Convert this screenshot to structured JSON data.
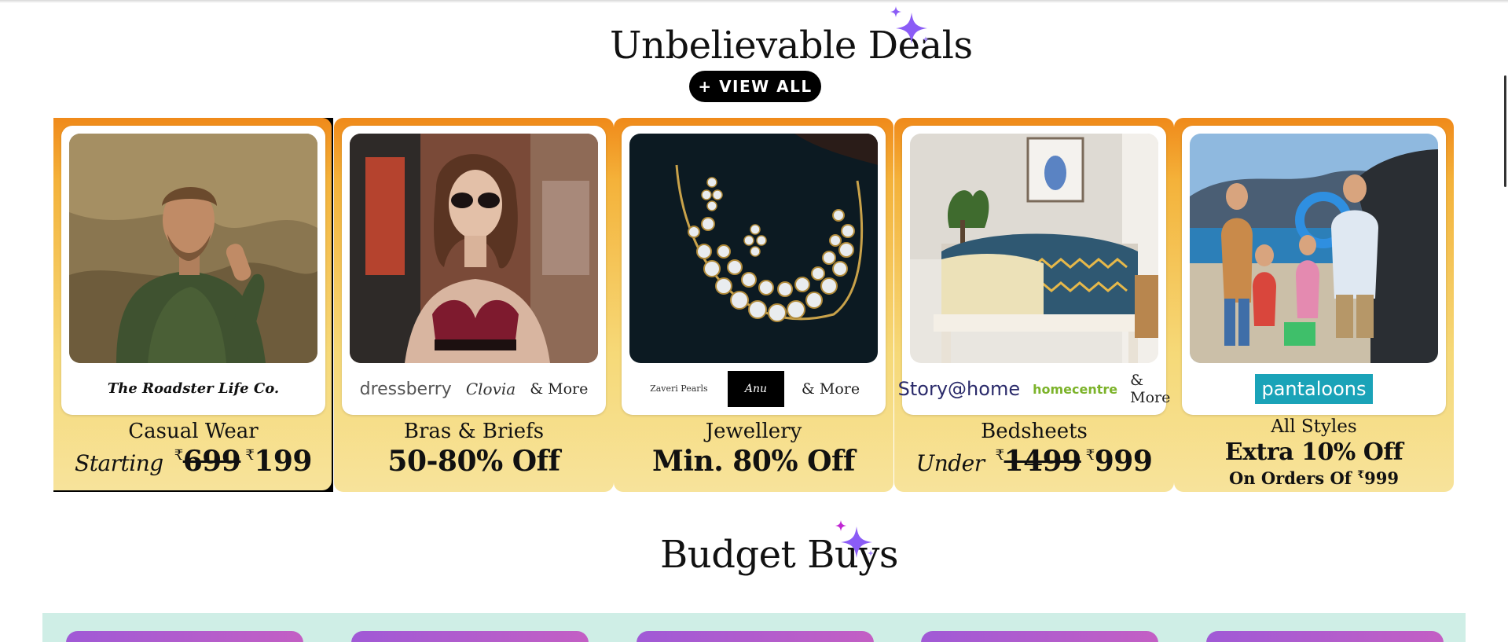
{
  "sections": {
    "deals": {
      "title": "Unbelievable Deals",
      "view_all_label": "+ VIEW ALL"
    },
    "budget": {
      "title": "Budget Buys"
    }
  },
  "colors": {
    "accent_sparkle": "#8b5cf6",
    "card_gradient_top": "#f08a1a",
    "card_gradient_bottom": "#f7e39b",
    "budget_strip": "#cfeee6",
    "pill": "#b05ed0"
  },
  "cards": [
    {
      "brand_logos": [
        "The Roadster Life Co."
      ],
      "more_label": "",
      "line1": "Casual Wear",
      "line2_prefix": "Starting",
      "old_price_symbol": "₹",
      "old_price": "699",
      "new_price_symbol": "₹",
      "new_price": "199"
    },
    {
      "brand_logos": [
        "dressberry",
        "Clovia"
      ],
      "more_label": "& More",
      "line1": "Bras & Briefs",
      "line2": "50-80% Off"
    },
    {
      "brand_logos": [
        "Zaveri Pearls",
        "Anu"
      ],
      "more_label": "& More",
      "line1": "Jewellery",
      "line2": "Min. 80% Off"
    },
    {
      "brand_logos": [
        "Story@home",
        "homecentre"
      ],
      "more_label": "& More",
      "line1": "Bedsheets",
      "line2_prefix": "Under",
      "old_price_symbol": "₹",
      "old_price": "1499",
      "new_price_symbol": "₹",
      "new_price": "999"
    },
    {
      "brand_logos": [
        "pantaloons"
      ],
      "more_label": "",
      "line1": "All Styles",
      "line2": "Extra 10% Off",
      "line3_prefix": "On Orders Of",
      "line3_symbol": "₹",
      "line3_value": "999"
    }
  ],
  "budget_pill_count": 5
}
